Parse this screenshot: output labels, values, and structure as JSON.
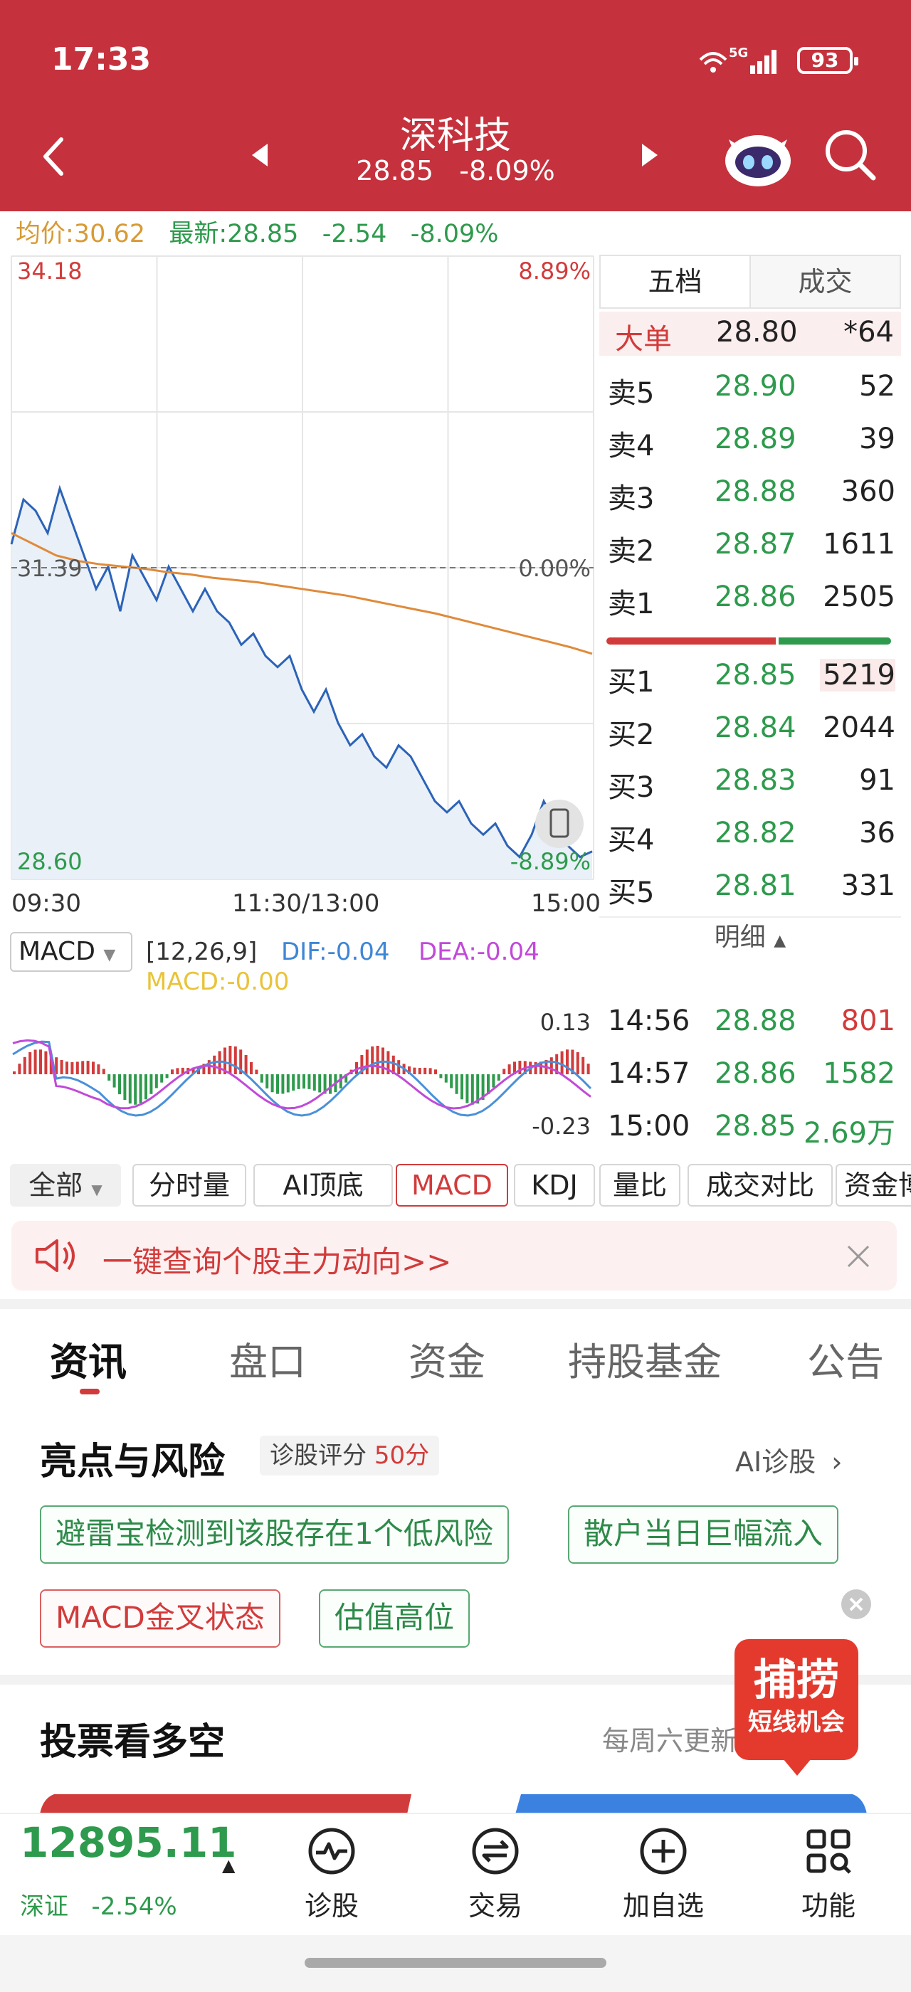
{
  "status_bar": {
    "time": "17:33",
    "network": "5G",
    "battery": "93"
  },
  "header": {
    "title": "深科技",
    "price": "28.85",
    "change_pct": "-8.09%"
  },
  "info_line": {
    "avg_label": "均价:",
    "avg_value": "30.62",
    "latest_label": "最新:",
    "latest_value": "28.85",
    "change": "-2.54",
    "change_pct": "-8.09%"
  },
  "intraday_chart": {
    "y_top_price": "34.18",
    "y_mid_price": "31.39",
    "y_bottom_price": "28.60",
    "y_top_pct": "8.89%",
    "y_mid_pct": "0.00%",
    "y_bottom_pct": "-8.89%",
    "time_start": "09:30",
    "time_mid": "11:30/13:00",
    "time_end": "15:00"
  },
  "chart_data": {
    "type": "line",
    "ylim": [
      28.6,
      34.18
    ],
    "baseline": 31.39,
    "series": [
      {
        "values": [
          31.6,
          32.0,
          31.9,
          31.7,
          32.1,
          31.8,
          31.5,
          31.2,
          31.4,
          31.0,
          31.5,
          31.3,
          31.1,
          31.4,
          31.2,
          31.0,
          31.2,
          31.0,
          30.9,
          30.7,
          30.8,
          30.6,
          30.5,
          30.6,
          30.3,
          30.1,
          30.3,
          30.0,
          29.8,
          29.9,
          29.7,
          29.6,
          29.8,
          29.7,
          29.5,
          29.3,
          29.2,
          29.3,
          29.1,
          29.0,
          29.1,
          28.9,
          28.8,
          29.0,
          29.3,
          29.1,
          28.9,
          28.8,
          28.85
        ]
      },
      {
        "values": [
          31.7,
          31.6,
          31.5,
          31.45,
          31.42,
          31.4,
          31.38,
          31.35,
          31.33,
          31.3,
          31.28,
          31.26,
          31.23,
          31.2,
          31.17,
          31.14,
          31.1,
          31.06,
          31.02,
          30.98,
          30.93,
          30.88,
          30.83,
          30.78,
          30.73,
          30.68,
          30.62
        ]
      }
    ]
  },
  "macd": {
    "selector": "MACD",
    "params": "[12,26,9]",
    "dif": "DIF:-0.04",
    "dea": "DEA:-0.04",
    "macd": "MACD:-0.00",
    "y_top": "0.13",
    "y_bottom": "-0.23"
  },
  "orderbook": {
    "tabs": [
      "五档",
      "成交"
    ],
    "big_order": {
      "label": "大单",
      "price": "28.80",
      "volume": "*64"
    },
    "asks": [
      {
        "label": "卖5",
        "price": "28.90",
        "volume": "52"
      },
      {
        "label": "卖4",
        "price": "28.89",
        "volume": "39"
      },
      {
        "label": "卖3",
        "price": "28.88",
        "volume": "360"
      },
      {
        "label": "卖2",
        "price": "28.87",
        "volume": "1611"
      },
      {
        "label": "卖1",
        "price": "28.86",
        "volume": "2505"
      }
    ],
    "bids": [
      {
        "label": "买1",
        "price": "28.85",
        "volume": "5219"
      },
      {
        "label": "买2",
        "price": "28.84",
        "volume": "2044"
      },
      {
        "label": "买3",
        "price": "28.83",
        "volume": "91"
      },
      {
        "label": "买4",
        "price": "28.82",
        "volume": "36"
      },
      {
        "label": "买5",
        "price": "28.81",
        "volume": "331"
      }
    ],
    "detail_label": "明细",
    "trades": [
      {
        "time": "14:56",
        "price": "28.88",
        "volume": "801"
      },
      {
        "time": "14:57",
        "price": "28.86",
        "volume": "1582"
      },
      {
        "time": "15:00",
        "price": "28.85",
        "volume": "2.69万"
      }
    ]
  },
  "indicator_tabs": [
    "全部",
    "分时量",
    "AI顶底",
    "MACD",
    "KDJ",
    "量比",
    "成交对比",
    "资金博"
  ],
  "banner": {
    "text": "一键查询个股主力动向>>"
  },
  "main_tabs": [
    "资讯",
    "盘口",
    "资金",
    "持股基金",
    "公告"
  ],
  "highlights": {
    "title": "亮点与风险",
    "score_label": "诊股评分",
    "score_value": "50分",
    "link": "AI诊股",
    "tags": [
      "避雷宝检测到该股存在1个低风险",
      "散户当日巨幅流入",
      "MACD金叉状态",
      "估值高位"
    ]
  },
  "vote": {
    "title": "投票看多空",
    "subtitle": "每周六更新",
    "promo_line1": "捕捞",
    "promo_line2": "短线机会"
  },
  "bottom_bar": {
    "index_value": "12895.11",
    "index_name": "深证",
    "index_change": "-2.54%",
    "items": [
      "诊股",
      "交易",
      "加自选",
      "功能"
    ]
  }
}
